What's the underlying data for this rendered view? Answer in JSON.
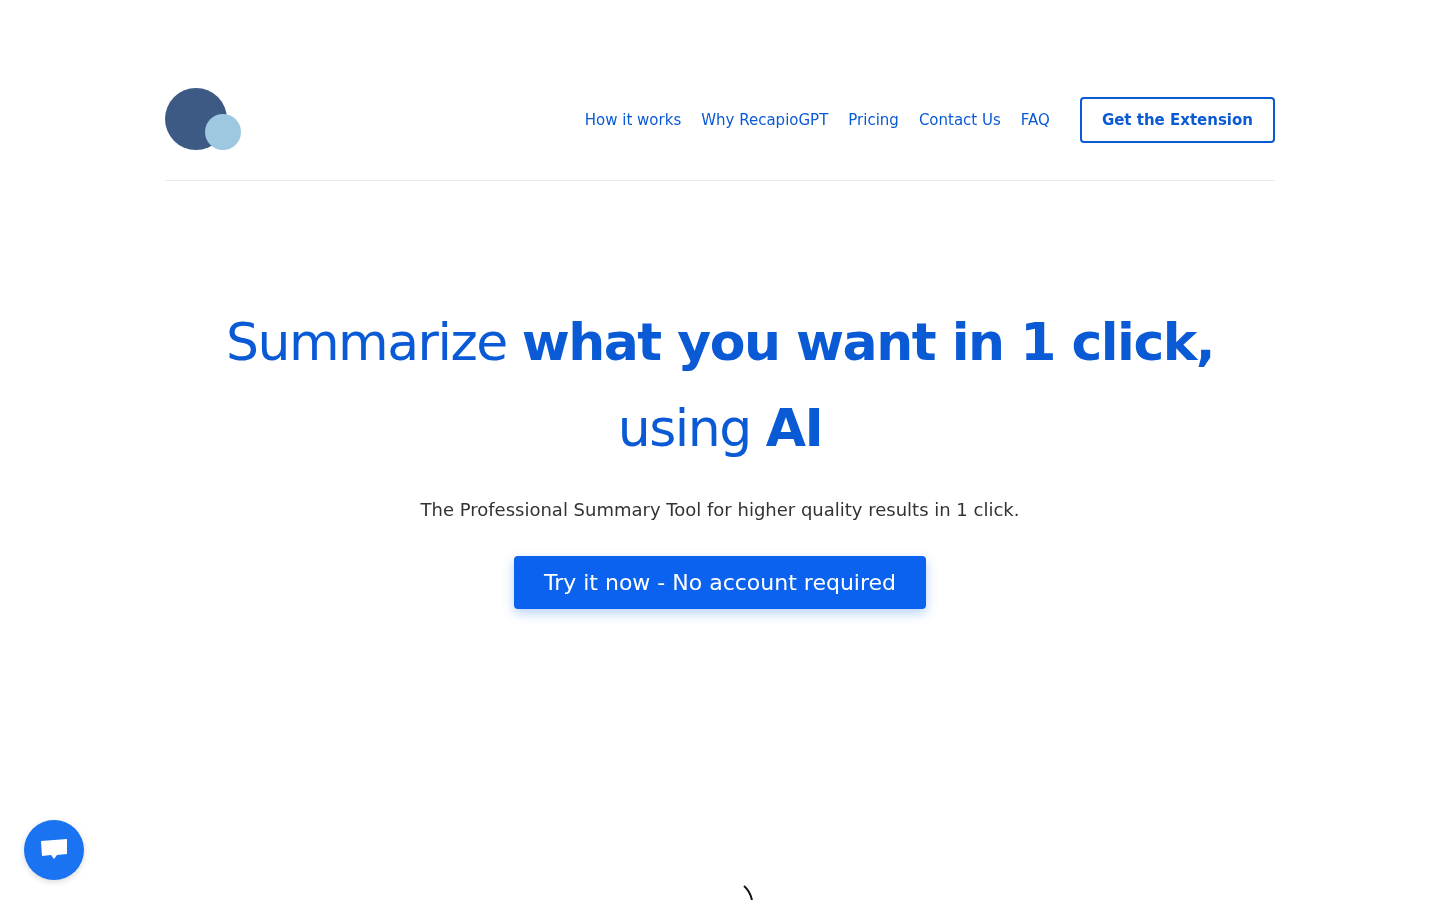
{
  "nav": {
    "links": [
      {
        "label": "How it works"
      },
      {
        "label": "Why RecapioGPT"
      },
      {
        "label": "Pricing"
      },
      {
        "label": "Contact Us"
      },
      {
        "label": "FAQ"
      }
    ],
    "cta": "Get the Extension"
  },
  "hero": {
    "headline_lines": [
      "Summarize **what you want in 1 click,**",
      "using **AI**"
    ],
    "subtitle": "The Professional Summary Tool for higher quality results in 1 click.",
    "button": "Try it now - No account required"
  }
}
